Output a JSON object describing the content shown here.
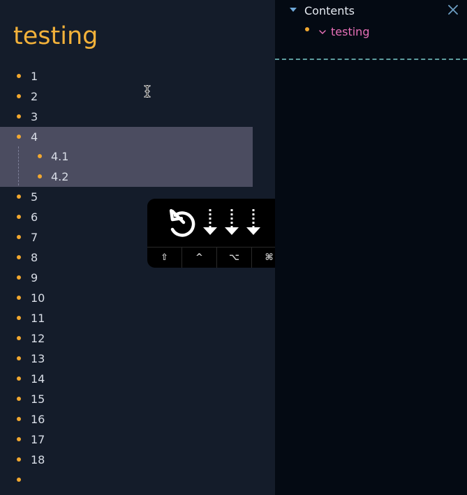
{
  "document": {
    "title": "testing",
    "items": [
      {
        "label": "1",
        "level": 0
      },
      {
        "label": "2",
        "level": 0
      },
      {
        "label": "3",
        "level": 0
      },
      {
        "label": "4",
        "level": 0
      },
      {
        "label": "4.1",
        "level": 1
      },
      {
        "label": "4.2",
        "level": 1
      },
      {
        "label": "5",
        "level": 0
      },
      {
        "label": "6",
        "level": 0
      },
      {
        "label": "7",
        "level": 0
      },
      {
        "label": "8",
        "level": 0
      },
      {
        "label": "9",
        "level": 0
      },
      {
        "label": "10",
        "level": 0
      },
      {
        "label": "11",
        "level": 0
      },
      {
        "label": "12",
        "level": 0
      },
      {
        "label": "13",
        "level": 0
      },
      {
        "label": "14",
        "level": 0
      },
      {
        "label": "15",
        "level": 0
      },
      {
        "label": "16",
        "level": 0
      },
      {
        "label": "17",
        "level": 0
      },
      {
        "label": "18",
        "level": 0
      },
      {
        "label": "",
        "level": 0
      }
    ]
  },
  "overlay": {
    "icons": [
      "undo-icon",
      "dotted-down-arrow-icon",
      "dotted-down-arrow-icon",
      "dotted-down-arrow-icon"
    ],
    "keys": [
      {
        "glyph": "⇧",
        "name": "shift-key"
      },
      {
        "glyph": "^",
        "name": "control-key"
      },
      {
        "glyph": "⌥",
        "name": "option-key"
      },
      {
        "glyph": "⌘",
        "name": "command-key"
      }
    ]
  },
  "sidebar": {
    "title": "Contents",
    "toc": [
      {
        "label": "testing"
      }
    ]
  },
  "colors": {
    "accent": "#f2a82f",
    "title": "#f2b13a",
    "toc_link": "#e870b8",
    "selection": "#4b4c60",
    "divider": "#5e9ea0"
  }
}
